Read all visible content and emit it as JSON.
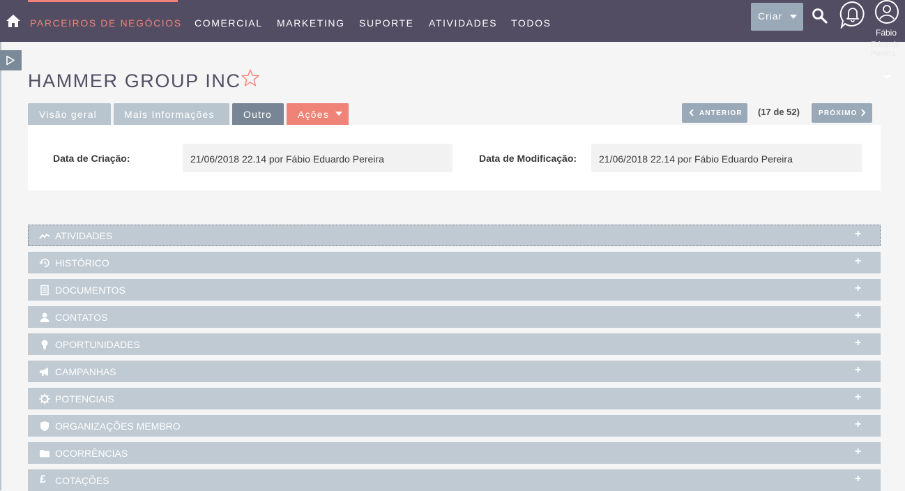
{
  "nav": {
    "items": [
      "PARCEIROS DE NEGÓCIOS",
      "COMERCIAL",
      "MARKETING",
      "SUPORTE",
      "ATIVIDADES",
      "TODOS"
    ],
    "active_index": 0,
    "create_label": "Criar",
    "user_name": "Fábio",
    "user_name_rest": "Eduardo Pereira"
  },
  "record": {
    "title": "HAMMER GROUP INC"
  },
  "tabs": [
    "Visão geral",
    "Mais Informações",
    "Outro",
    "Ações"
  ],
  "pagination": {
    "prev_label": "ANTERIOR",
    "counter": "(17 de 52)",
    "next_label": "PRÓXIMO"
  },
  "fields": {
    "created_label": "Data de Criação:",
    "created_value": "21/06/2018 22.14 por Fábio Eduardo Pereira",
    "modified_label": "Data de Modificação:",
    "modified_value": "21/06/2018 22.14 por Fábio Eduardo Pereira"
  },
  "subpanels": [
    {
      "label": "ATIVIDADES",
      "icon": "activity-icon"
    },
    {
      "label": "HISTÓRICO",
      "icon": "history-icon"
    },
    {
      "label": "DOCUMENTOS",
      "icon": "document-icon"
    },
    {
      "label": "CONTATOS",
      "icon": "person-icon"
    },
    {
      "label": "OPORTUNIDADES",
      "icon": "lightbulb-icon"
    },
    {
      "label": "CAMPANHAS",
      "icon": "megaphone-icon"
    },
    {
      "label": "POTENCIAIS",
      "icon": "gear-icon"
    },
    {
      "label": "ORGANIZAÇÕES MEMBRO",
      "icon": "shield-icon"
    },
    {
      "label": "OCORRÊNCIAS",
      "icon": "folder-icon"
    },
    {
      "label": "COTAÇÕES",
      "icon": "pound-icon"
    }
  ],
  "colors": {
    "nav_bg": "#534d64",
    "accent": "#f08377",
    "tab_grey": "#b8c4ce",
    "tab_selected": "#788594",
    "subpanel_bg": "#bfcad3"
  }
}
